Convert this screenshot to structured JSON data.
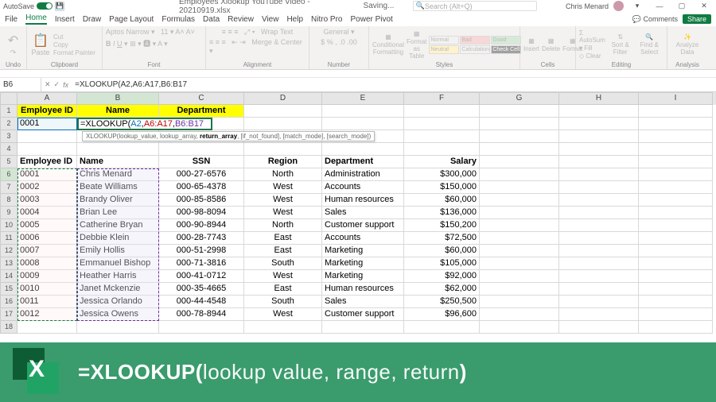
{
  "titlebar": {
    "autosave": "AutoSave",
    "filename": "Employees Xlookup YouTube Video - 20210919.xlsx",
    "saving": "Saving... ",
    "search_placeholder": "Search (Alt+Q)",
    "user": "Chris Menard"
  },
  "menu": {
    "items": [
      "File",
      "Home",
      "Insert",
      "Draw",
      "Page Layout",
      "Formulas",
      "Data",
      "Review",
      "View",
      "Help",
      "Nitro Pro",
      "Power Pivot"
    ],
    "active_index": 1,
    "comments": "Comments",
    "share": "Share"
  },
  "ribbon": {
    "undo": "Undo",
    "clipboard": {
      "label": "Clipboard",
      "paste": "Paste",
      "cut": "Cut",
      "copy": "Copy",
      "painter": "Format Painter"
    },
    "font": {
      "label": "Font",
      "wrap": "Wrap Text",
      "merge": "Merge & Center"
    },
    "alignment": {
      "label": "Alignment"
    },
    "number": {
      "label": "Number"
    },
    "styles": {
      "label": "Styles",
      "cond": "Conditional Formatting",
      "fmt": "Format as Table",
      "normal": "Normal",
      "bad": "Bad",
      "good": "Good",
      "neutral": "Neutral",
      "calc": "Calculation",
      "check": "Check Cell"
    },
    "cells": {
      "label": "Cells",
      "insert": "Insert",
      "delete": "Delete",
      "format": "Format"
    },
    "editing": {
      "label": "Editing",
      "autosum": "AutoSum",
      "fill": "Fill",
      "clear": "Clear",
      "sort": "Sort & Filter",
      "find": "Find & Select"
    },
    "analysis": {
      "label": "Analysis",
      "analyze": "Analyze Data"
    }
  },
  "namebox": "B6",
  "formula_bar": "=XLOOKUP(A2,A6:A17,B6:B17",
  "formula_parts": {
    "fn": "=XLOOKUP(",
    "a1": "A2",
    "c": ",",
    "a2": "A6:A17",
    "a3": "B6:B17"
  },
  "tooltip_prefix": "XLOOKUP(lookup_value, lookup_array, ",
  "tooltip_bold": "return_array",
  "tooltip_suffix": ", [if_not_found], [match_mode], [search_mode])",
  "columns": [
    "A",
    "B",
    "C",
    "D",
    "E",
    "F",
    "G",
    "H",
    "I"
  ],
  "row_headers": [
    1,
    2,
    3,
    4,
    5,
    6,
    7,
    8,
    9,
    10,
    11,
    12,
    13,
    14,
    15,
    16,
    17,
    18
  ],
  "yellow_headers": {
    "A": "Employee ID",
    "B": "Name",
    "C": "Department"
  },
  "a2_value": "0001",
  "table_headers": {
    "A": "Employee ID",
    "B": "Name",
    "C": "SSN",
    "D": "Region",
    "E": "Department",
    "F": "Salary"
  },
  "table": [
    {
      "id": "0001",
      "name": "Chris Menard",
      "ssn": "000-27-6576",
      "region": "North",
      "dept": "Administration",
      "salary": "$300,000"
    },
    {
      "id": "0002",
      "name": "Beate Williams",
      "ssn": "000-65-4378",
      "region": "West",
      "dept": "Accounts",
      "salary": "$150,000"
    },
    {
      "id": "0003",
      "name": "Brandy Oliver",
      "ssn": "000-85-8586",
      "region": "West",
      "dept": "Human resources",
      "salary": "$60,000"
    },
    {
      "id": "0004",
      "name": "Brian Lee",
      "ssn": "000-98-8094",
      "region": "West",
      "dept": "Sales",
      "salary": "$136,000"
    },
    {
      "id": "0005",
      "name": "Catherine Bryan",
      "ssn": "000-90-8944",
      "region": "North",
      "dept": "Customer support",
      "salary": "$150,200"
    },
    {
      "id": "0006",
      "name": "Debbie Klein",
      "ssn": "000-28-7743",
      "region": "East",
      "dept": "Accounts",
      "salary": "$72,500"
    },
    {
      "id": "0007",
      "name": "Emily Hollis",
      "ssn": "000-51-2998",
      "region": "East",
      "dept": "Marketing",
      "salary": "$60,000"
    },
    {
      "id": "0008",
      "name": "Emmanuel Bishop",
      "ssn": "000-71-3816",
      "region": "South",
      "dept": "Marketing",
      "salary": "$105,000"
    },
    {
      "id": "0009",
      "name": "Heather Harris",
      "ssn": "000-41-0712",
      "region": "West",
      "dept": "Marketing",
      "salary": "$92,000"
    },
    {
      "id": "0010",
      "name": "Janet Mckenzie",
      "ssn": "000-35-4665",
      "region": "East",
      "dept": "Human resources",
      "salary": "$62,000"
    },
    {
      "id": "0011",
      "name": "Jessica Orlando",
      "ssn": "000-44-4548",
      "region": "South",
      "dept": "Sales",
      "salary": "$250,500"
    },
    {
      "id": "0012",
      "name": "Jessica Owens",
      "ssn": "000-78-8944",
      "region": "West",
      "dept": "Customer support",
      "salary": "$96,600"
    }
  ],
  "banner": {
    "fn": "=XLOOKUP(",
    "args": "lookup value, range, return",
    ")": ")"
  }
}
